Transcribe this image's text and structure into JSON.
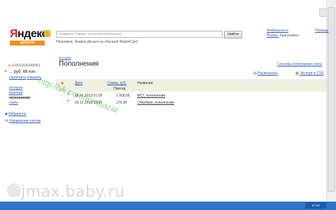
{
  "header": {
    "logo_ya": "Я",
    "logo_rest": "ндекс",
    "logo_sub": "деньги",
    "search_placeholder": "название товара, услуги или магазина",
    "search_button": "Найти",
    "search_hint": "Например, Яндекс.Деньги на обычной MasterCard",
    "right_link_1": "Мобильность",
    "right_link_2": "Помощь",
    "region_label": "Регион:",
    "region_value": "Красноярск"
  },
  "left": {
    "account_number": "410011536646951",
    "balance": "... руб. 68 коп.",
    "balance_sub_1": "пополнить",
    "balance_sub_2": "показать",
    "nav": [
      "История",
      "платежи",
      "пополнения",
      "счета"
    ],
    "favorites": "Избранное",
    "manage_account": "Управление счетом"
  },
  "main": {
    "breadcrumb": "История",
    "title": "Пополнения",
    "ways_link": "Способы пополнения счета",
    "print_link": "Распечатать",
    "export_link": "Экспорт в CSV",
    "columns": {
      "date": "Дата",
      "amount": "Сумма, руб.",
      "name": "Название",
      "income": "Приход"
    },
    "rows": [
      {
        "date": "26.01.2013 01:09",
        "amount": "1 000.00",
        "name": "ФСТ, пополнение"
      },
      {
        "date": "26.12.2012 13:57",
        "amount": "170.00",
        "name": "Сбербанк, пополнение"
      }
    ]
  },
  "watermark": {
    "url": "http://vk.com/mmbazar",
    "site": "jmax.baby.ru"
  },
  "taskbar": {
    "time": "17:10"
  },
  "colors": {
    "link": "#2a5bb5",
    "logo_red": "#e01f1f",
    "brand_orange": "#f2931c",
    "table_header_bg": "#eef1e1",
    "taskbar": "#2f76c9"
  }
}
